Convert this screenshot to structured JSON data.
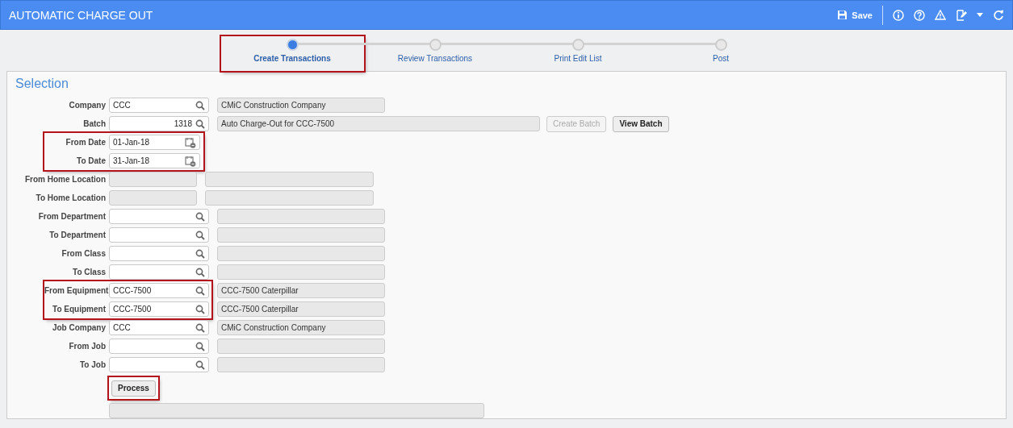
{
  "window": {
    "title": "AUTOMATIC CHARGE OUT",
    "save_label": "Save"
  },
  "steps": [
    {
      "label": "Create Transactions",
      "selected": true,
      "highlighted": true
    },
    {
      "label": "Review Transactions",
      "selected": false,
      "highlighted": false
    },
    {
      "label": "Print Edit List",
      "selected": false,
      "highlighted": false
    },
    {
      "label": "Post",
      "selected": false,
      "highlighted": false
    }
  ],
  "section_title": "Selection",
  "groups": [
    {
      "highlighted": false,
      "rows": [
        {
          "kind": "lookup",
          "label": "Company",
          "value": "CCC",
          "description": "CMiC Construction Company"
        },
        {
          "kind": "batch",
          "label": "Batch",
          "value": "1318",
          "description": "Auto Charge-Out for CCC-7500",
          "buttons": [
            {
              "label": "Create Batch",
              "disabled": true
            },
            {
              "label": "View Batch",
              "disabled": false
            }
          ]
        }
      ]
    },
    {
      "highlighted": true,
      "rows": [
        {
          "kind": "date",
          "label": "From Date",
          "value": "01-Jan-18"
        },
        {
          "kind": "date",
          "label": "To Date",
          "value": "31-Jan-18"
        }
      ]
    },
    {
      "highlighted": false,
      "rows": [
        {
          "kind": "plain",
          "label": "From Home Location"
        },
        {
          "kind": "plain",
          "label": "To Home Location"
        },
        {
          "kind": "lookup",
          "label": "From Department"
        },
        {
          "kind": "lookup",
          "label": "To Department"
        },
        {
          "kind": "lookup",
          "label": "From Class"
        },
        {
          "kind": "lookup",
          "label": "To Class"
        }
      ]
    },
    {
      "highlighted": true,
      "rows": [
        {
          "kind": "lookup",
          "label": "From Equipment",
          "value": "CCC-7500",
          "description": "CCC-7500 Caterpillar"
        },
        {
          "kind": "lookup",
          "label": "To Equipment",
          "value": "CCC-7500",
          "description": "CCC-7500 Caterpillar"
        }
      ]
    },
    {
      "highlighted": false,
      "rows": [
        {
          "kind": "lookup",
          "label": "Job Company",
          "value": "CCC",
          "description": "CMiC Construction Company"
        },
        {
          "kind": "lookup",
          "label": "From Job"
        },
        {
          "kind": "lookup",
          "label": "To Job"
        }
      ]
    }
  ],
  "process_button": {
    "label": "Process",
    "highlighted": true
  }
}
